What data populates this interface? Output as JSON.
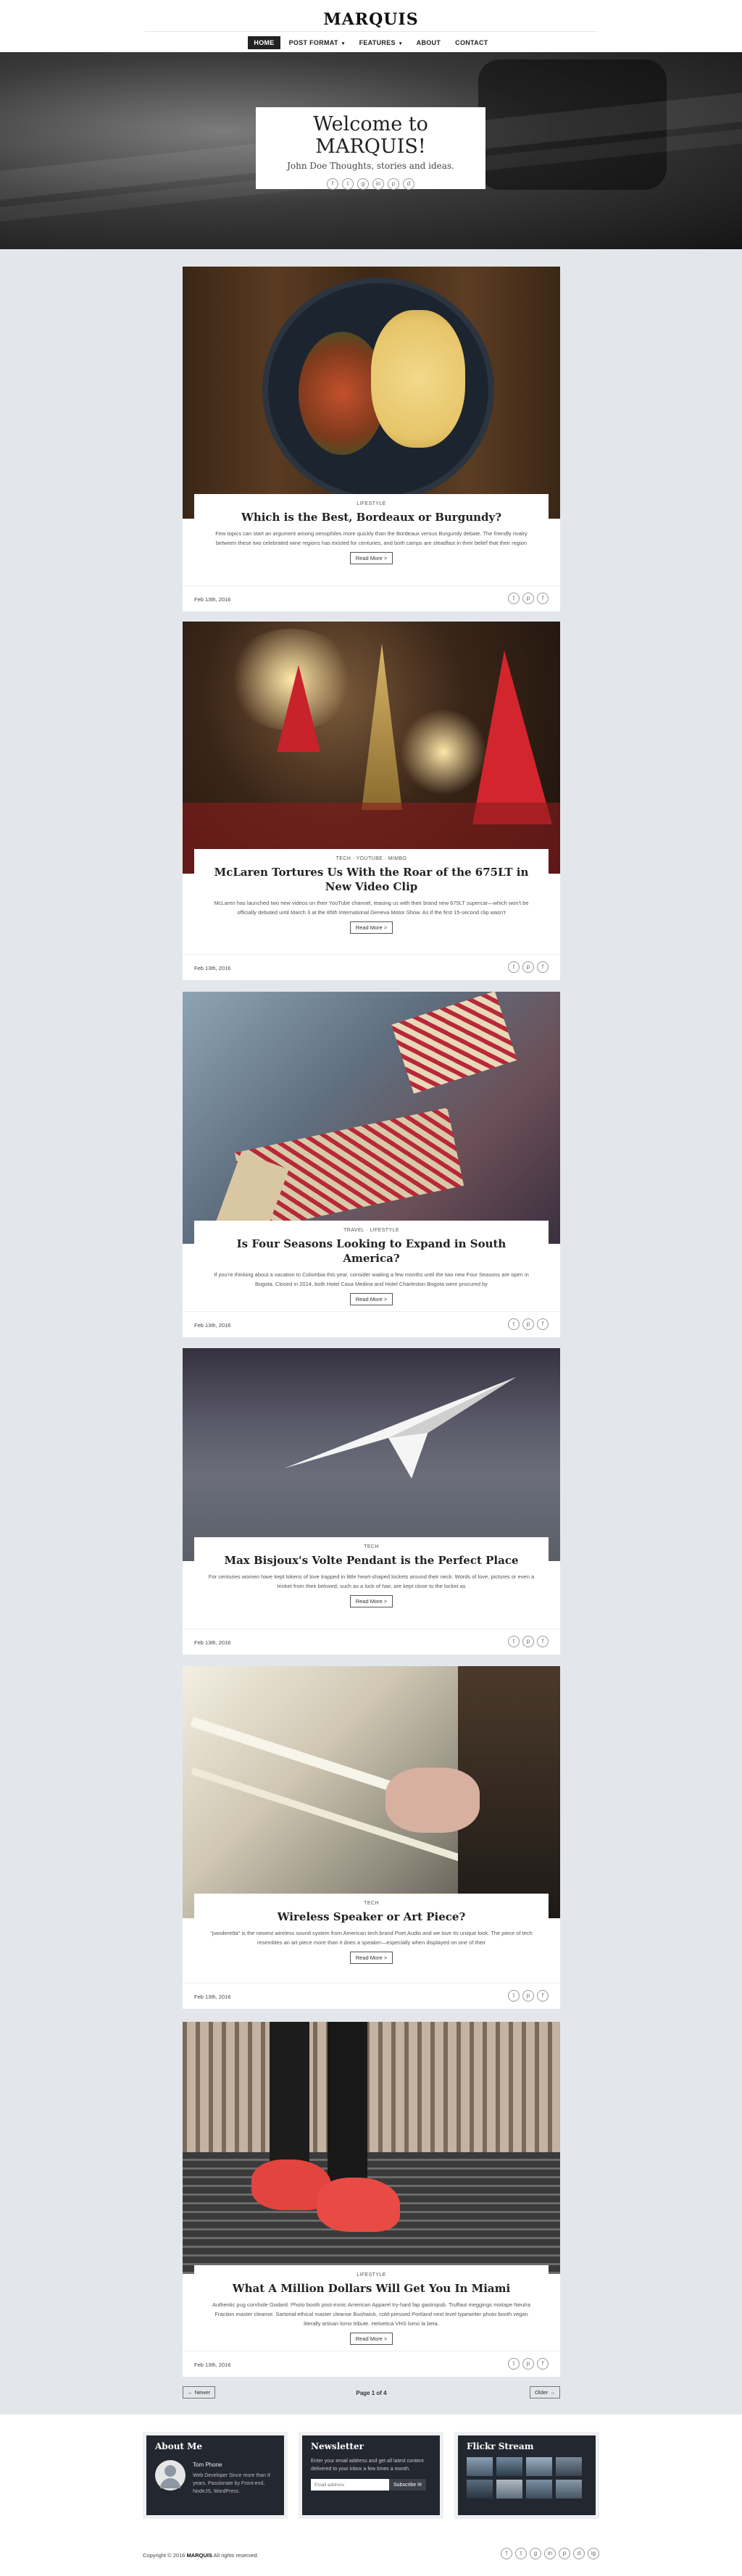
{
  "site": {
    "logo": "MARQUIS"
  },
  "nav": {
    "items": [
      {
        "label": "Home",
        "caret": ""
      },
      {
        "label": "Post Format",
        "caret": "▾"
      },
      {
        "label": "Features",
        "caret": "▾"
      },
      {
        "label": "About",
        "caret": ""
      },
      {
        "label": "Contact",
        "caret": ""
      }
    ]
  },
  "hero": {
    "title": "Welcome to MARQUIS!",
    "subtitle": "John Doe Thoughts, stories and ideas.",
    "social_icons": [
      "f",
      "t",
      "g",
      "in",
      "p",
      "d"
    ]
  },
  "posts": [
    {
      "category": "Lifestyle",
      "title": "Which is the Best, Bordeaux or Burgundy?",
      "excerpt": "Few topics can start an argument among oenophiles more quickly than the Bordeaux versus Burgundy debate. The friendly rivalry between these two celebrated wine regions has existed for centuries, and both camps are steadfast in their belief that their region",
      "read_more": "Read More >",
      "date": "Feb 13th, 2016"
    },
    {
      "category": "Tech · Youtube · Mimbo",
      "title": "McLaren Tortures Us With the Roar of the 675LT in New Video Clip",
      "excerpt": "McLaren has launched two new videos on their YouTube channel, teasing us with their brand new 675LT supercar—which won't be officially debuted until March 3 at the 85th International Geneva Motor Show. As if the first 15-second clip wasn't",
      "read_more": "Read More >",
      "date": "Feb 13th, 2016"
    },
    {
      "category": "Travel · Lifestyle",
      "title": "Is Four Seasons Looking to Expand in South America?",
      "excerpt": "If you're thinking about a vacation to Colombia this year, consider waiting a few months until the two new Four Seasons are open in Bogota. Closed in 2014, both Hotel Casa Medina and Hotel Charleston Bogota were procured by",
      "read_more": "Read More >",
      "date": "Feb 13th, 2016"
    },
    {
      "category": "Tech",
      "title": "Max Bisjoux's Volte Pendant is the Perfect Place",
      "excerpt": "For centuries women have kept tokens of love trapped in little heart-shaped lockets around their neck. Words of love, pictures or even a trinket from their beloved, such as a lock of hair, are kept close to the locket as",
      "read_more": "Read More >",
      "date": "Feb 13th, 2016"
    },
    {
      "category": "Tech",
      "title": "Wireless Speaker or Art Piece?",
      "excerpt": "\"panderetta\" is the newest wireless sound system from American tech brand Poet Audio and we love its unique look. The piece of tech resembles an art piece more than it does a speaker—especially when displayed on one of their",
      "read_more": "Read More >",
      "date": "Feb 13th, 2016"
    },
    {
      "category": "Lifestyle",
      "title": "What A Million Dollars Will Get You In Miami",
      "excerpt": "Authentic pug cornhole Godard. Photo booth post-ironic American Apparel try-hard fap gastropub. Truffaut meggings mixtape Neutra Fraction master cleanse. Sartorial ethical master cleanse Bushwick, cold-pressed Portland next level typewriter photo booth vegan literally artisan lomo tribute. Helvetica VHS lomo la beta.",
      "read_more": "Read More >",
      "date": "Feb 13th, 2016"
    }
  ],
  "share_icons": [
    "t",
    "p",
    "f"
  ],
  "pagination": {
    "newer": "← Newer",
    "info": "Page 1 of 4",
    "older": "Older →"
  },
  "footer": {
    "about": {
      "title": "About Me",
      "name": "Tom Phone",
      "desc": "Web Developer Since more than 8 years. Passionate by Front-end, NodeJS, WordPress."
    },
    "newsletter": {
      "title": "Newsletter",
      "text": "Enter your email address and get all latest content delivered to your inbox a few times a month.",
      "placeholder": "Email address",
      "button": "Subscribe ✉"
    },
    "flickr": {
      "title": "Flickr Stream"
    },
    "copyright_prefix": "Copyright © 2016 ",
    "copyright_brand": "MARQUIS",
    "copyright_suffix": " All rights reserved.",
    "social_icons": [
      "f",
      "t",
      "g",
      "in",
      "p",
      "d",
      "ig"
    ]
  },
  "colors": {
    "background": "#e3e7eb",
    "dark": "#222222",
    "widget": "#23272f"
  }
}
